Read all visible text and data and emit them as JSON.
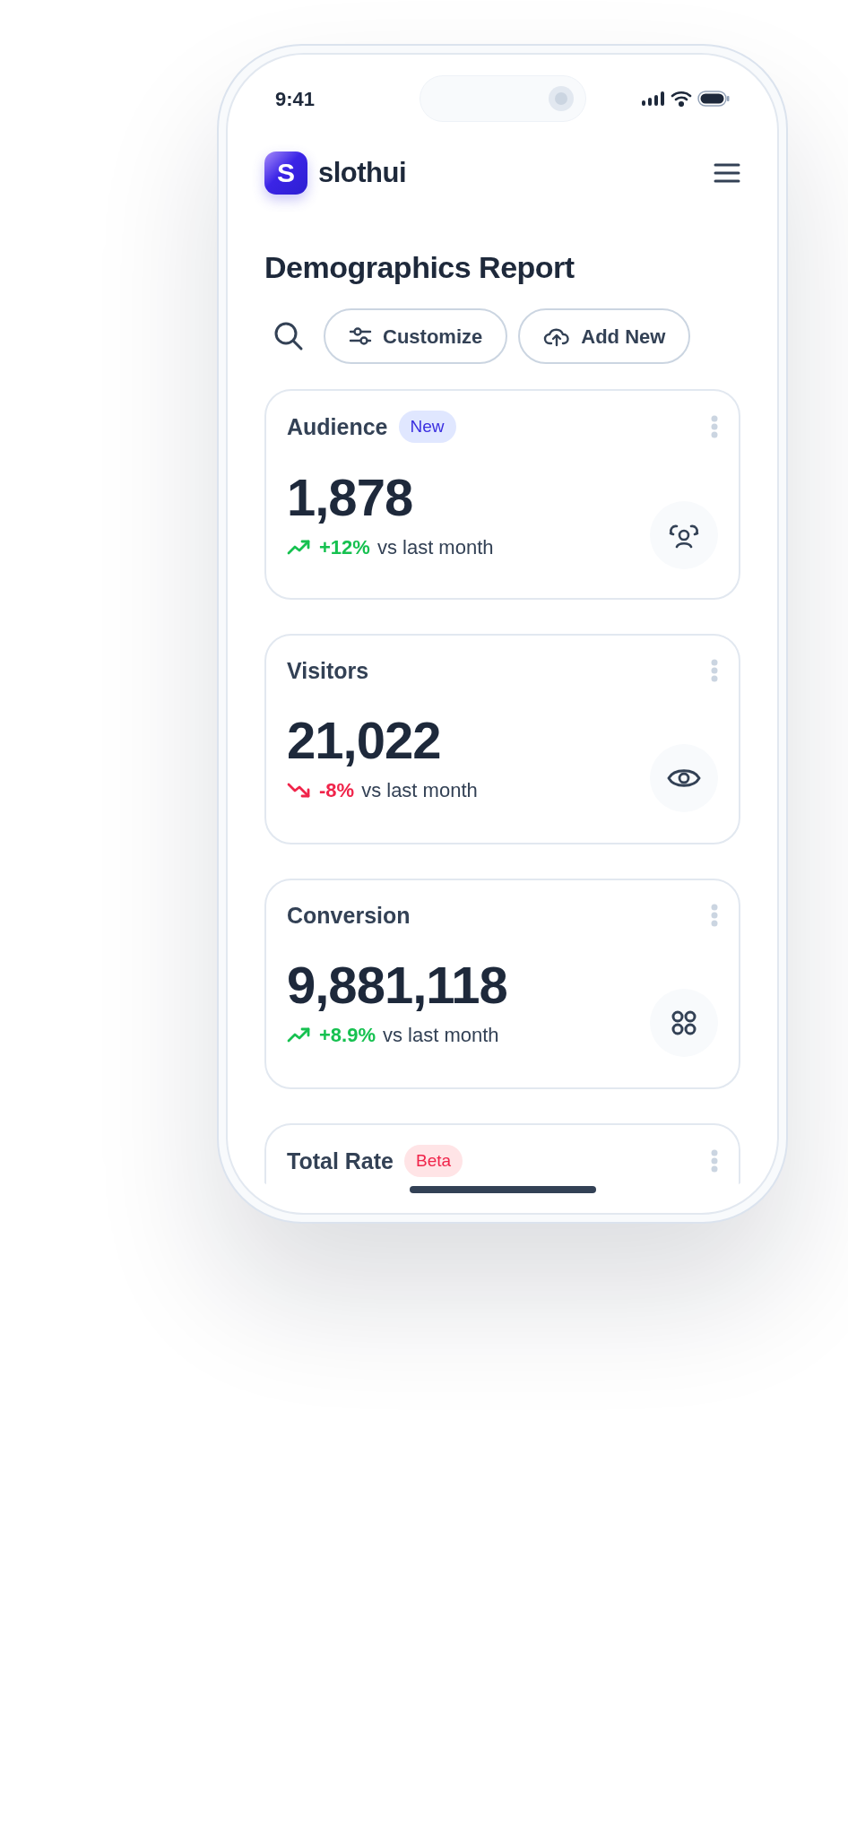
{
  "status_bar": {
    "time": "9:41"
  },
  "brand": {
    "logo_letter": "S",
    "name": "slothui"
  },
  "title": "Demographics Report",
  "toolbar": {
    "buttons": [
      {
        "label": "Customize",
        "kind": "customize"
      },
      {
        "label": "Add New",
        "kind": "add"
      }
    ]
  },
  "cards": [
    {
      "title": "Audience",
      "badge": {
        "label": "New",
        "kind": "new"
      },
      "value": "1,878",
      "rising": true,
      "change": "+12%",
      "comparison": "vs last month"
    },
    {
      "title": "Visitors",
      "value": "21,022",
      "rising": false,
      "change": "-8%",
      "comparison": "vs last month"
    },
    {
      "title": "Conversion",
      "value": "9,881,118",
      "rising": true,
      "change": "+8.9%",
      "comparison": "vs last month"
    },
    {
      "title": "Total Rate",
      "badge": {
        "label": "Beta",
        "kind": "beta"
      }
    }
  ]
}
